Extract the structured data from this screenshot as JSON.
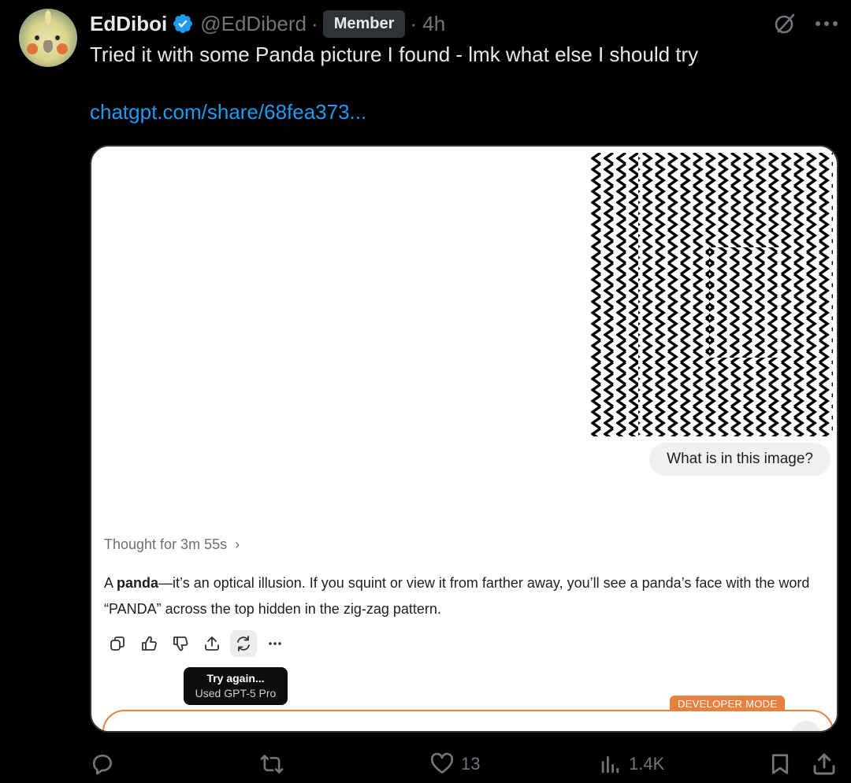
{
  "post": {
    "display_name": "EdDiboi",
    "handle": "@EdDiberd",
    "separator": "·",
    "badge": "Member",
    "time": "· 4h",
    "text": "Tried it with some Panda picture I found - lmk what else I should try",
    "link": "chatgpt.com/share/68fea373..."
  },
  "card": {
    "user_message": "What is in this image?",
    "thought_label": "Thought for 3m 55s",
    "thought_chevron": "›",
    "answer_bold": "panda",
    "answer_pre": "A ",
    "answer_post": "—it’s an optical illusion. If you squint or view it from farther away, you’ll see a panda’s face with the word “PANDA” across the top hidden in the zig-zag pattern.",
    "tooltip_title": "Try again...",
    "tooltip_sub": "Used GPT-5 Pro",
    "developer_mode": "DEVELOPER MODE",
    "action_icons": [
      "copy-icon",
      "thumbs-up-icon",
      "thumbs-down-icon",
      "share-icon",
      "regenerate-icon",
      "more-icon"
    ]
  },
  "footer": {
    "reply_count": "",
    "repost_count": "",
    "like_count": "13",
    "view_count": "1.4K"
  },
  "colors": {
    "link": "#1d9bf0",
    "muted": "#71767b",
    "verified": "#1d9bf0",
    "developer_accent": "#e8813f"
  }
}
